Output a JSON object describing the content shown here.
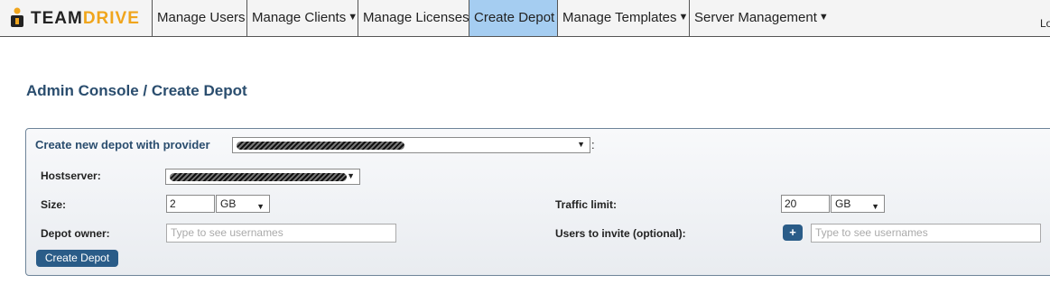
{
  "app": {
    "logo_text_part1": "TEAM",
    "logo_text_part2": "DRIVE",
    "logo_icon": "teamdrive-logo-icon"
  },
  "nav": {
    "items": [
      {
        "label": "Manage Users",
        "has_dropdown": false,
        "active": false
      },
      {
        "label": "Manage Clients",
        "has_dropdown": true,
        "active": false
      },
      {
        "label": "Manage Licenses",
        "has_dropdown": false,
        "active": false
      },
      {
        "label": "Create Depot",
        "has_dropdown": false,
        "active": true
      },
      {
        "label": "Manage Templates",
        "has_dropdown": true,
        "active": false
      },
      {
        "label": "Server Management",
        "has_dropdown": true,
        "active": false
      }
    ],
    "dropdown_glyph": "▼",
    "right_text": "Lo"
  },
  "page": {
    "breadcrumb_title": "Admin Console / Create Depot"
  },
  "form": {
    "heading": "Create new depot with provider",
    "provider_colon": ":",
    "hostserver_label": "Hostserver:",
    "size_label": "Size:",
    "size_value": "2",
    "size_unit": "GB",
    "traffic_label": "Traffic limit:",
    "traffic_value": "20",
    "traffic_unit": "GB",
    "owner_label": "Depot owner:",
    "owner_placeholder": "Type to see usernames",
    "invite_label": "Users to invite (optional):",
    "invite_placeholder": "Type to see usernames",
    "invite_add_label": "+",
    "submit_label": "Create Depot"
  },
  "colors": {
    "nav_active": "#a5cdf1",
    "title_blue": "#2a4d6e",
    "button_blue": "#2a5c88",
    "logo_orange": "#f0a51c"
  }
}
